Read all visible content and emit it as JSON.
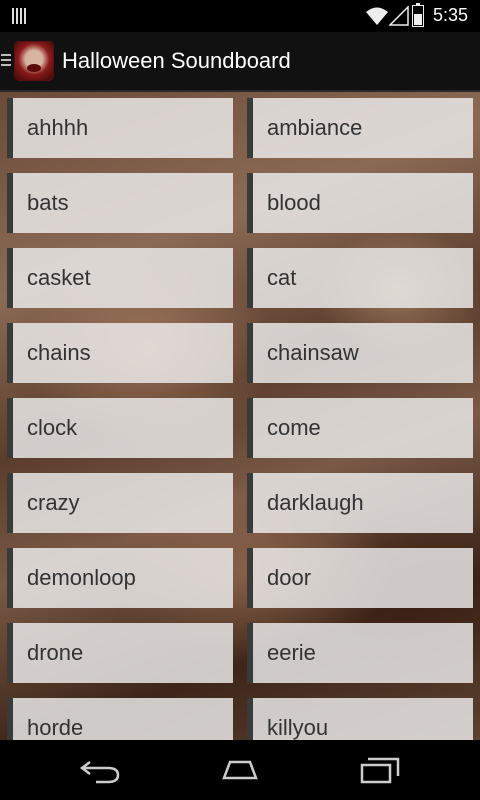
{
  "status_bar": {
    "time": "5:35",
    "battery_level": 0.6,
    "icons": [
      "notification-bars-icon",
      "wifi-icon",
      "signal-icon",
      "battery-icon"
    ]
  },
  "action_bar": {
    "title": "Halloween Soundboard",
    "app_icon": "zombie-face-icon",
    "drawer_icon": "drawer-indicator-icon"
  },
  "sounds": [
    {
      "label": "ahhhh"
    },
    {
      "label": "ambiance"
    },
    {
      "label": "bats"
    },
    {
      "label": "blood"
    },
    {
      "label": "casket"
    },
    {
      "label": "cat"
    },
    {
      "label": "chains"
    },
    {
      "label": "chainsaw"
    },
    {
      "label": "clock"
    },
    {
      "label": "come"
    },
    {
      "label": "crazy"
    },
    {
      "label": "darklaugh"
    },
    {
      "label": "demonloop"
    },
    {
      "label": "door"
    },
    {
      "label": "drone"
    },
    {
      "label": "eerie"
    },
    {
      "label": "horde"
    },
    {
      "label": "killyou"
    }
  ],
  "nav_bar": {
    "icons": [
      "back-icon",
      "home-icon",
      "recent-apps-icon"
    ]
  }
}
